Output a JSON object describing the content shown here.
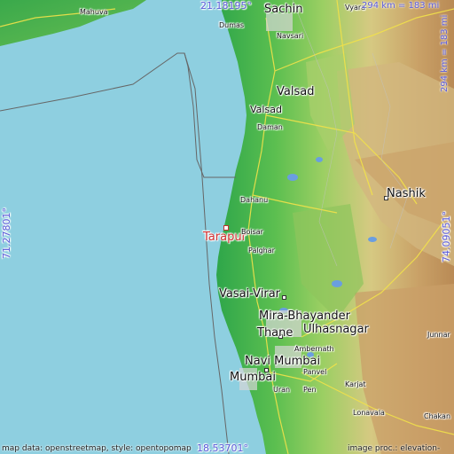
{
  "map": {
    "target_place": "Tarapur",
    "coords": {
      "top": "21.18195°",
      "bottom": "18.53701°",
      "left": "71.27801°",
      "right": "74.09051°"
    },
    "scale": {
      "top": "294 km = 183 mi",
      "right": "294 km = 183 mi"
    },
    "attribution": {
      "left": "map data: openstreetmap, style: opentopomap",
      "right": "image proc.: elevation-"
    },
    "cities_major": [
      "Sachin",
      "Valsad",
      "Nashik",
      "Vasai-Virar",
      "Mira-Bhayander",
      "Thane",
      "Ulhasnagar",
      "Navi Mumbai",
      "Mumbai"
    ],
    "cities_minor": [
      "Mahuva",
      "Dumas",
      "Navsari",
      "Vyara",
      "Daman",
      "Dahanu",
      "Boisar",
      "Palghar",
      "Ambernath",
      "Uran",
      "Panvel",
      "Karjat",
      "Junnar",
      "Chakan",
      "Lonavala",
      "Pen"
    ],
    "colors": {
      "sea": "#8ecfe0",
      "lowland": "#3fb04a",
      "highland": "#c9a86a",
      "target": "#d03030",
      "coord_text": "#5a5ad8"
    }
  }
}
